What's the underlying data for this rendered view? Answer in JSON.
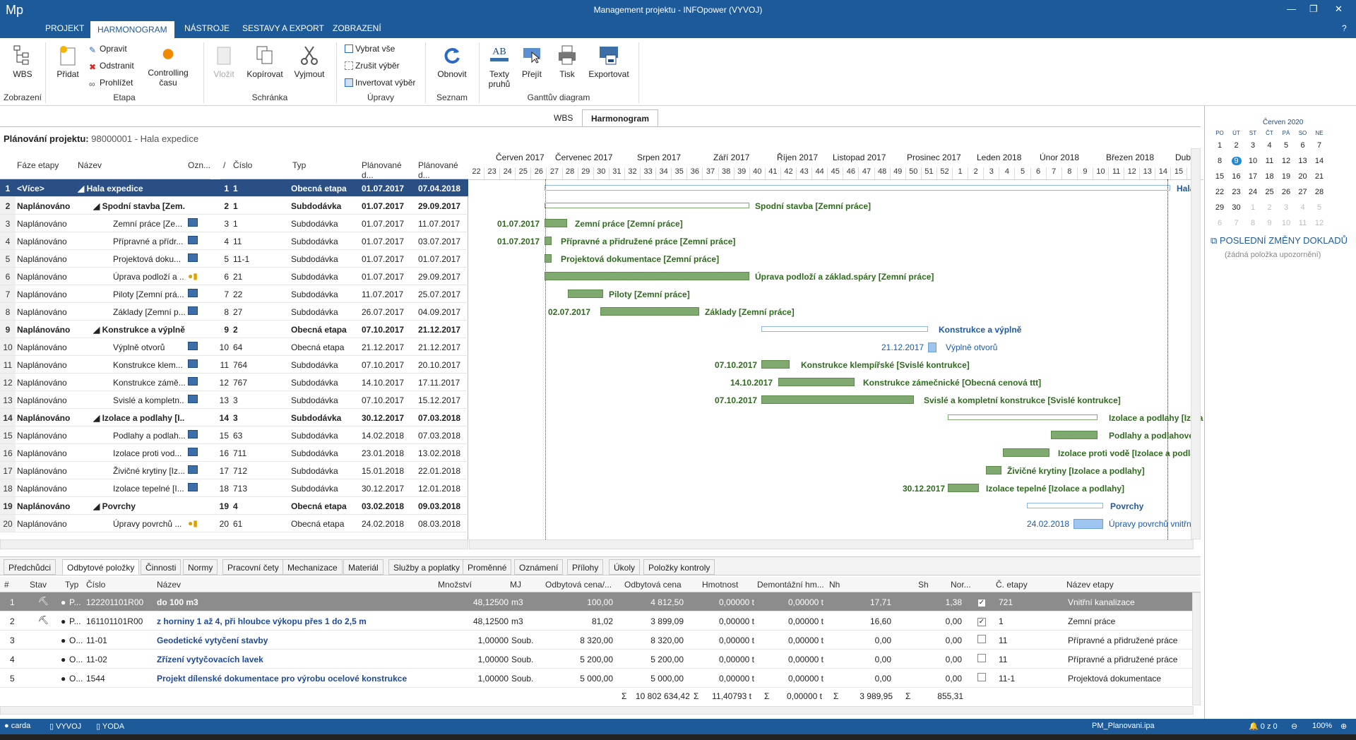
{
  "app": {
    "logo": "Mp",
    "title": "Management projektu - INFOpower (VYVOJ)"
  },
  "menu": [
    "PROJEKT",
    "HARMONOGRAM",
    "NÁSTROJE",
    "SESTAVY A EXPORT",
    "ZOBRAZENÍ"
  ],
  "ribbon": {
    "wbs": "WBS",
    "pridat": "Přidat",
    "opravit": "Opravit",
    "odstranit": "Odstranit",
    "prohlizet": "Prohlížet",
    "controlling1": "Controlling",
    "controlling2": "času",
    "vlozit": "Vložit",
    "kopirovat": "Kopírovat",
    "vyjmout": "Vyjmout",
    "vybrat": "Vybrat vše",
    "zrusit": "Zrušit výběr",
    "invertovat": "Invertovat výběr",
    "obnovit": "Obnovit",
    "texty1": "Texty",
    "texty2": "pruhů",
    "prejit": "Přejít",
    "tisk": "Tisk",
    "exportovat": "Exportovat",
    "groups": {
      "zobrazeni": "Zobrazení",
      "etapa": "Etapa",
      "schranka": "Schránka",
      "upravy": "Úpravy",
      "seznam": "Seznam",
      "gantt": "Ganttův diagram"
    },
    "ab": "AB"
  },
  "viewtabs": [
    "WBS",
    "Harmonogram"
  ],
  "project": {
    "label": "Plánování projektu:",
    "value": "98000001 - Hala expedice"
  },
  "grid": {
    "headers": [
      "Fáze etapy",
      "Název",
      "Ozn...",
      "/",
      "Číslo",
      "Typ",
      "Plánované d...",
      "Plánované d..."
    ],
    "rows": [
      {
        "n": "1",
        "faze": "<Více>",
        "nazev": "◢ Hala expedice",
        "o": "1",
        "c": "1",
        "typ": "Obecná etapa",
        "d1": "01.07.2017",
        "d2": "07.04.2018",
        "sel": true,
        "bold": true,
        "ind": 0
      },
      {
        "n": "2",
        "faze": "Naplánováno",
        "nazev": "◢ Spodní stavba [Zem...",
        "o": "2",
        "c": "1",
        "typ": "Subdodávka",
        "d1": "01.07.2017",
        "d2": "29.09.2017",
        "bold": true,
        "ind": 1
      },
      {
        "n": "3",
        "faze": "Naplánováno",
        "nazev": "Zemní práce [Ze...",
        "o": "3",
        "c": "1",
        "typ": "Subdodávka",
        "d1": "01.07.2017",
        "d2": "11.07.2017",
        "ind": 2,
        "ic": "cal"
      },
      {
        "n": "4",
        "faze": "Naplánováno",
        "nazev": "Přípravné a přídr...",
        "o": "4",
        "c": "11",
        "typ": "Subdodávka",
        "d1": "01.07.2017",
        "d2": "03.07.2017",
        "ind": 2,
        "ic": "cal"
      },
      {
        "n": "5",
        "faze": "Naplánováno",
        "nazev": "Projektová doku...",
        "o": "5",
        "c": "11-1",
        "typ": "Subdodávka",
        "d1": "01.07.2017",
        "d2": "01.07.2017",
        "ind": 2,
        "ic": "cal"
      },
      {
        "n": "6",
        "faze": "Naplánováno",
        "nazev": "Úprava podloží a ...",
        "o": "6",
        "c": "21",
        "typ": "Subdodávka",
        "d1": "01.07.2017",
        "d2": "29.09.2017",
        "ind": 2,
        "ic": "user"
      },
      {
        "n": "7",
        "faze": "Naplánováno",
        "nazev": "Piloty [Zemní prá...",
        "o": "7",
        "c": "22",
        "typ": "Subdodávka",
        "d1": "11.07.2017",
        "d2": "25.07.2017",
        "ind": 2,
        "ic": "cal"
      },
      {
        "n": "8",
        "faze": "Naplánováno",
        "nazev": "Základy [Zemní p...",
        "o": "8",
        "c": "27",
        "typ": "Subdodávka",
        "d1": "26.07.2017",
        "d2": "04.09.2017",
        "ind": 2,
        "ic": "cal"
      },
      {
        "n": "9",
        "faze": "Naplánováno",
        "nazev": "◢ Konstrukce a výplně",
        "o": "9",
        "c": "2",
        "typ": "Obecná etapa",
        "d1": "07.10.2017",
        "d2": "21.12.2017",
        "bold": true,
        "ind": 1
      },
      {
        "n": "10",
        "faze": "Naplánováno",
        "nazev": "Výplně otvorů",
        "o": "10",
        "c": "64",
        "typ": "Obecná etapa",
        "d1": "21.12.2017",
        "d2": "21.12.2017",
        "ind": 2,
        "ic": "cal"
      },
      {
        "n": "11",
        "faze": "Naplánováno",
        "nazev": "Konstrukce klem...",
        "o": "11",
        "c": "764",
        "typ": "Subdodávka",
        "d1": "07.10.2017",
        "d2": "20.10.2017",
        "ind": 2,
        "ic": "cal"
      },
      {
        "n": "12",
        "faze": "Naplánováno",
        "nazev": "Konstrukce zámě...",
        "o": "12",
        "c": "767",
        "typ": "Subdodávka",
        "d1": "14.10.2017",
        "d2": "17.11.2017",
        "ind": 2,
        "ic": "cal"
      },
      {
        "n": "13",
        "faze": "Naplánováno",
        "nazev": "Svislé a kompletn...",
        "o": "13",
        "c": "3",
        "typ": "Subdodávka",
        "d1": "07.10.2017",
        "d2": "15.12.2017",
        "ind": 2,
        "ic": "cal"
      },
      {
        "n": "14",
        "faze": "Naplánováno",
        "nazev": "◢ Izolace a podlahy [I...",
        "o": "14",
        "c": "3",
        "typ": "Subdodávka",
        "d1": "30.12.2017",
        "d2": "07.03.2018",
        "bold": true,
        "ind": 1
      },
      {
        "n": "15",
        "faze": "Naplánováno",
        "nazev": "Podlahy a podlah...",
        "o": "15",
        "c": "63",
        "typ": "Subdodávka",
        "d1": "14.02.2018",
        "d2": "07.03.2018",
        "ind": 2,
        "ic": "cal"
      },
      {
        "n": "16",
        "faze": "Naplánováno",
        "nazev": "Izolace proti vod...",
        "o": "16",
        "c": "711",
        "typ": "Subdodávka",
        "d1": "23.01.2018",
        "d2": "13.02.2018",
        "ind": 2,
        "ic": "cal"
      },
      {
        "n": "17",
        "faze": "Naplánováno",
        "nazev": "Živičné krytiny [Iz...",
        "o": "17",
        "c": "712",
        "typ": "Subdodávka",
        "d1": "15.01.2018",
        "d2": "22.01.2018",
        "ind": 2,
        "ic": "cal"
      },
      {
        "n": "18",
        "faze": "Naplánováno",
        "nazev": "Izolace tepelné [I...",
        "o": "18",
        "c": "713",
        "typ": "Subdodávka",
        "d1": "30.12.2017",
        "d2": "12.01.2018",
        "ind": 2,
        "ic": "cal"
      },
      {
        "n": "19",
        "faze": "Naplánováno",
        "nazev": "◢ Povrchy",
        "o": "19",
        "c": "4",
        "typ": "Obecná etapa",
        "d1": "03.02.2018",
        "d2": "09.03.2018",
        "bold": true,
        "ind": 1
      },
      {
        "n": "20",
        "faze": "Naplánováno",
        "nazev": "Úpravy povrchů ...",
        "o": "20",
        "c": "61",
        "typ": "Obecná etapa",
        "d1": "24.02.2018",
        "d2": "08.03.2018",
        "ind": 2,
        "ic": "user"
      }
    ]
  },
  "timeline": {
    "months": [
      "Červen 2017",
      "Červenec 2017",
      "Srpen 2017",
      "Září 2017",
      "Říjen 2017",
      "Listopad 2017",
      "Prosinec 2017",
      "Leden 2018",
      "Únor 2018",
      "Březen 2018",
      "Dube"
    ],
    "weeks": [
      "22",
      "23",
      "24",
      "25",
      "26",
      "27",
      "28",
      "29",
      "30",
      "31",
      "32",
      "33",
      "34",
      "35",
      "36",
      "37",
      "38",
      "39",
      "40",
      "41",
      "42",
      "43",
      "44",
      "45",
      "46",
      "47",
      "48",
      "49",
      "50",
      "51",
      "52",
      "1",
      "2",
      "3",
      "4",
      "5",
      "6",
      "7",
      "8",
      "9",
      "10",
      "11",
      "12",
      "13",
      "14",
      "15"
    ]
  },
  "gantt_labels": {
    "r1": "Hala",
    "r2": "Spodní stavba [Zemní práce]",
    "r3": "Zemní práce [Zemní práce]",
    "r3d": "01.07.2017",
    "r4": "Přípravné a přidružené práce [Zemní práce]",
    "r4d": "01.07.2017",
    "r5": "Projektová dokumentace [Zemní práce]",
    "r6": "Úprava podloží a základ.spáry [Zemní práce]",
    "r7": "Piloty [Zemní práce]",
    "r8": "Základy [Zemní práce]",
    "r8d": "02.07.2017",
    "r9": "Konstrukce a výplně",
    "r10": "Výplně otvorů",
    "r10d": "21.12.2017",
    "r11": "Konstrukce klempířské [Svislé kontrukce]",
    "r11d": "07.10.2017",
    "r12": "Konstrukce zámečnické [Obecná cenová ttt]",
    "r12d": "14.10.2017",
    "r13": "Svislé a kompletní konstrukce [Svislé kontrukce]",
    "r13d": "07.10.2017",
    "r14": "Izolace a podlahy [Izola",
    "r15": "Podlahy a podlahové k",
    "r16": "Izolace proti vodě [Izolace a podlah",
    "r17": "Živičné krytiny [Izolace a podlahy]",
    "r18": "Izolace tepelné [Izolace a podlahy]",
    "r18d": "30.12.2017",
    "r19": "Povrchy",
    "r20": "Úpravy povrchů vnitřní",
    "r20d": "24.02.2018"
  },
  "calendar": {
    "month": "Červen 2020",
    "days": [
      "PO",
      "ÚT",
      "ST",
      "ČT",
      "PÁ",
      "SO",
      "NE"
    ],
    "weeks": [
      [
        "1",
        "2",
        "3",
        "4",
        "5",
        "6",
        "7"
      ],
      [
        "8",
        "9",
        "10",
        "11",
        "12",
        "13",
        "14"
      ],
      [
        "15",
        "16",
        "17",
        "18",
        "19",
        "20",
        "21"
      ],
      [
        "22",
        "23",
        "24",
        "25",
        "26",
        "27",
        "28"
      ],
      [
        "29",
        "30",
        "1",
        "2",
        "3",
        "4",
        "5"
      ],
      [
        "6",
        "7",
        "8",
        "9",
        "10",
        "11",
        "12"
      ]
    ],
    "today": "9"
  },
  "changes": {
    "title": "POSLEDNÍ ZMĚNY DOKLADŮ",
    "empty": "(žádná položka upozornění)"
  },
  "bottabs": [
    "Předchůdci",
    "Odbytové položky",
    "Činnosti",
    "Normy",
    "Pracovní čety",
    "Mechanizace",
    "Materiál",
    "Služby a poplatky",
    "Proměnné",
    "Oznámení",
    "Přílohy",
    "Úkoly",
    "Položky kontroly"
  ],
  "btable": {
    "headers": [
      "#",
      "Stav",
      "Typ",
      "Číslo",
      "Název",
      "Množství",
      "MJ",
      "Odbytová cena/...",
      "Odbytová cena",
      "Hmotnost",
      "Demontážní hm...",
      "Nh",
      "Sh",
      "Nor...",
      "Č. etapy",
      "Název etapy"
    ],
    "rows": [
      {
        "n": "1",
        "typ": "P...",
        "c": "122201101R00",
        "nazev": "do 100 m3",
        "mn": "48,12500",
        "mj": "m3",
        "oc1": "100,00",
        "oc": "4 812,50",
        "hm": "0,00000 t",
        "dh": "0,00000 t",
        "nh": "17,71",
        "sh": "1,38",
        "nor": true,
        "ce": "721",
        "ne": "Vnitřní kanalizace",
        "sel": true
      },
      {
        "n": "2",
        "typ": "P...",
        "c": "161101101R00",
        "nazev": "z horniny 1 až 4, při hloubce výkopu přes 1 do 2,5 m",
        "mn": "48,12500",
        "mj": "m3",
        "oc1": "81,02",
        "oc": "3 899,09",
        "hm": "0,00000 t",
        "dh": "0,00000 t",
        "nh": "16,60",
        "sh": "0,00",
        "nor": true,
        "ce": "1",
        "ne": "Zemní práce"
      },
      {
        "n": "3",
        "typ": "O...",
        "c": "11-01",
        "nazev": "Geodetické vytyčení stavby",
        "mn": "1,00000",
        "mj": "Soub.",
        "oc1": "8 320,00",
        "oc": "8 320,00",
        "hm": "0,00000 t",
        "dh": "0,00000 t",
        "nh": "0,00",
        "sh": "0,00",
        "nor": false,
        "ce": "11",
        "ne": "Přípravné a přidružené práce"
      },
      {
        "n": "4",
        "typ": "O...",
        "c": "11-02",
        "nazev": "Zřízení vytyčovacích lavek",
        "mn": "1,00000",
        "mj": "Soub.",
        "oc1": "5 200,00",
        "oc": "5 200,00",
        "hm": "0,00000 t",
        "dh": "0,00000 t",
        "nh": "0,00",
        "sh": "0,00",
        "nor": false,
        "ce": "11",
        "ne": "Přípravné a přidružené práce"
      },
      {
        "n": "5",
        "typ": "O...",
        "c": "1544",
        "nazev": "Projekt dílenské dokumentace pro výrobu ocelové konstrukce",
        "mn": "1,00000",
        "mj": "Soub.",
        "oc1": "5 000,00",
        "oc": "5 000,00",
        "hm": "0,00000 t",
        "dh": "0,00000 t",
        "nh": "0,00",
        "sh": "0,00",
        "nor": false,
        "ce": "11-1",
        "ne": "Projektová dokumentace"
      }
    ],
    "sums": {
      "oc": "10 802 634,42",
      "hm": "11,40793 t",
      "dh": "0,00000 t",
      "nh": "3 989,95",
      "sh": "855,31",
      "sigma": "Σ"
    }
  },
  "status": {
    "user": "carda",
    "db": "VYVOJ",
    "server": "YODA",
    "file": "PM_Planovani.ipa",
    "notif": "0 z 0",
    "zoom": "100%"
  },
  "colors": {
    "titlebar": "#1d5a9a",
    "gantt_green": "#7fa96e",
    "gantt_blue": "#9ec4f0"
  }
}
